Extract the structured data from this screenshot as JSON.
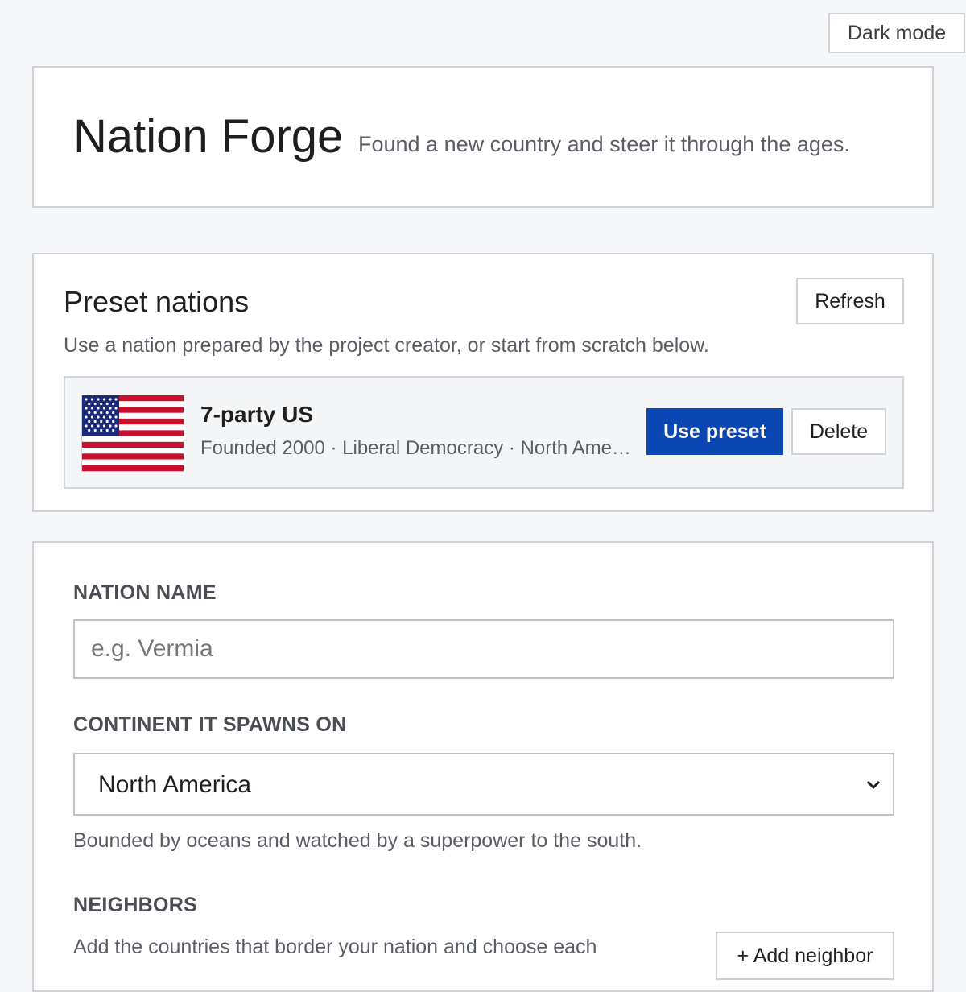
{
  "header": {
    "dark_mode_label": "Dark mode",
    "title": "Nation Forge",
    "subtitle": "Found a new country and steer it through the ages."
  },
  "presets": {
    "heading": "Preset nations",
    "refresh_label": "Refresh",
    "description": "Use a nation prepared by the project creator, or start from scratch below.",
    "items": [
      {
        "name": "7-party US",
        "meta": "Founded 2000 · Liberal Democracy · North Ameri…",
        "flag_icon": "us-flag-icon",
        "use_label": "Use preset",
        "delete_label": "Delete"
      }
    ]
  },
  "form": {
    "name_label": "NATION NAME",
    "name_value": "",
    "name_placeholder": "e.g. Vermia",
    "continent_label": "CONTINENT IT SPAWNS ON",
    "continent_value": "North America",
    "continent_hint": "Bounded by oceans and watched by a superpower to the south.",
    "neighbors_label": "NEIGHBORS",
    "neighbors_description": "Add the countries that border your nation and choose each",
    "add_neighbor_label": "+ Add neighbor"
  },
  "colors": {
    "primary": "#0b47b3",
    "background": "#f6f7f9",
    "border": "#cfd2d6",
    "flag_red": "#c8102e",
    "flag_blue": "#1a2a7a"
  }
}
